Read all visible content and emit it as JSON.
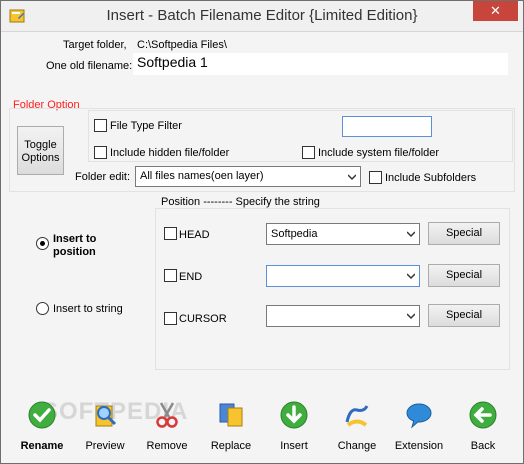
{
  "window": {
    "title": "Insert - Batch Filename Editor {Limited Edition}",
    "close": "✕"
  },
  "target_folder": {
    "label": "Target folder,",
    "value": "C:\\Softpedia Files\\"
  },
  "old_filename": {
    "label": "One old filename:",
    "value": "Softpedia 1"
  },
  "folder_option": {
    "title": "Folder Option",
    "toggle_button": "Toggle Options",
    "file_type_filter": "File Type Filter",
    "include_hidden": "Include hidden file/folder",
    "include_system": "Include system file/folder",
    "folder_edit_label": "Folder edit:",
    "folder_edit_value": "All files names(oen layer)",
    "include_subfolders": "Include Subfolders"
  },
  "mode": {
    "insert_to_position": "Insert to position",
    "insert_to_string": "Insert to string"
  },
  "position_panel": {
    "header": "Position  --------  Specify the string",
    "rows": [
      {
        "label": "HEAD",
        "value": "Softpedia",
        "special": "Special"
      },
      {
        "label": "END",
        "value": "",
        "special": "Special"
      },
      {
        "label": "CURSOR",
        "value": "",
        "special": "Special"
      }
    ]
  },
  "toolbar": {
    "watermark": "SOFTPEDIA",
    "items": [
      {
        "label": "Rename",
        "icon": "check-icon"
      },
      {
        "label": "Preview",
        "icon": "preview-icon"
      },
      {
        "label": "Remove",
        "icon": "scissors-icon"
      },
      {
        "label": "Replace",
        "icon": "replace-icon"
      },
      {
        "label": "Insert",
        "icon": "insert-arrow-icon"
      },
      {
        "label": "Change",
        "icon": "change-icon"
      },
      {
        "label": "Extension",
        "icon": "extension-icon"
      },
      {
        "label": "Back",
        "icon": "back-arrow-icon"
      }
    ]
  },
  "colors": {
    "accent_red": "#ff2020",
    "close_red": "#c7453a",
    "green": "#3fae3f"
  }
}
